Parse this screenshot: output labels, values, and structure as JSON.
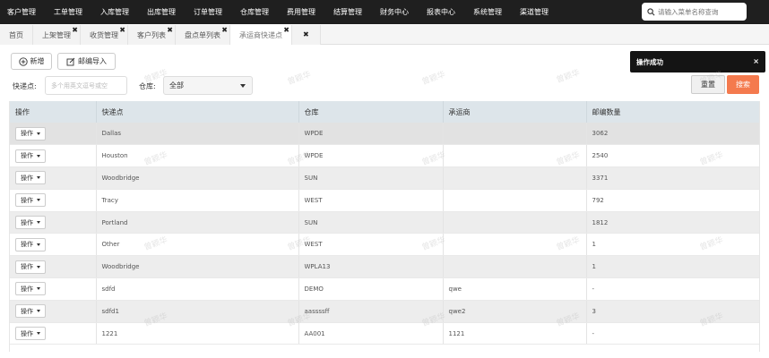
{
  "nav": {
    "items": [
      "客户管理",
      "工单管理",
      "入库管理",
      "出库管理",
      "订单管理",
      "仓库管理",
      "费用管理",
      "结算管理",
      "财务中心",
      "报表中心",
      "系统管理",
      "渠道管理"
    ],
    "search_placeholder": "请输入菜单名称查询"
  },
  "tabs": [
    {
      "label": "首页",
      "closable": false,
      "active": false
    },
    {
      "label": "上架管理",
      "closable": true,
      "active": false
    },
    {
      "label": "收货管理",
      "closable": true,
      "active": false
    },
    {
      "label": "客户列表",
      "closable": true,
      "active": false
    },
    {
      "label": "盘点单列表",
      "closable": true,
      "active": false
    },
    {
      "label": "承运商快递点",
      "closable": true,
      "active": true
    },
    {
      "label": "",
      "closable": true,
      "active": false
    }
  ],
  "toolbar": {
    "add_label": "新增",
    "import_label": "邮编导入"
  },
  "filters": {
    "express_label": "快递点:",
    "express_placeholder": "多个用英文逗号或空",
    "warehouse_label": "仓库:",
    "warehouse_value": "全部",
    "reset_label": "重置",
    "search_label": "搜索"
  },
  "toast": {
    "message": "操作成功",
    "close": "×"
  },
  "table": {
    "columns": [
      "操作",
      "快递点",
      "仓库",
      "承运商",
      "邮编数量"
    ],
    "action_label": "操作",
    "rows": [
      [
        "Dallas",
        "WPDE",
        "",
        "3062"
      ],
      [
        "Houston",
        "WPDE",
        "",
        "2540"
      ],
      [
        "Woodbridge",
        "SUN",
        "",
        "3371"
      ],
      [
        "Tracy",
        "WEST",
        "",
        "792"
      ],
      [
        "Portland",
        "SUN",
        "",
        "1812"
      ],
      [
        "Other",
        "WEST",
        "",
        "1"
      ],
      [
        "Woodbridge",
        "WPLA13",
        "",
        "1"
      ],
      [
        "sdfd",
        "DEMO",
        "qwe",
        "-"
      ],
      [
        "sdfd1",
        "aassssff",
        "qwe2",
        "3"
      ],
      [
        "1221",
        "AA001",
        "1121",
        "-"
      ]
    ]
  },
  "watermark_text": "曾颖华"
}
